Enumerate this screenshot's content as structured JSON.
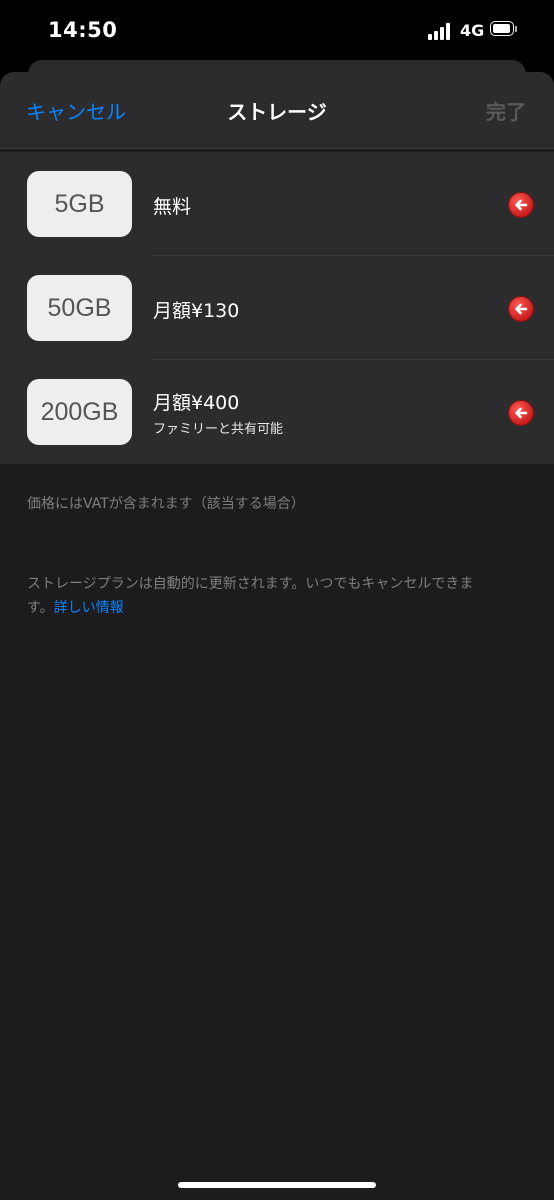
{
  "status": {
    "time": "14:50",
    "network": "4G"
  },
  "nav": {
    "cancel": "キャンセル",
    "title": "ストレージ",
    "done": "完了"
  },
  "plans": [
    {
      "capacity": "5GB",
      "price": "無料",
      "note": ""
    },
    {
      "capacity": "50GB",
      "price": "月額¥130",
      "note": ""
    },
    {
      "capacity": "200GB",
      "price": "月額¥400",
      "note": "ファミリーと共有可能"
    }
  ],
  "footer": {
    "vat": "価格にはVATが含まれます（該当する場合）",
    "renew_line1": "ストレージプランは自動的に更新されます。いつでもキャンセルできま",
    "renew_line2": "す。",
    "link": "詳しい情報"
  },
  "icons": {
    "select": "arrow-left-circle-icon",
    "signal": "cellular-signal-icon",
    "battery": "battery-icon"
  },
  "colors": {
    "accent": "#0a84ff",
    "select_red": "#d9262a",
    "background": "#1c1c1e"
  }
}
